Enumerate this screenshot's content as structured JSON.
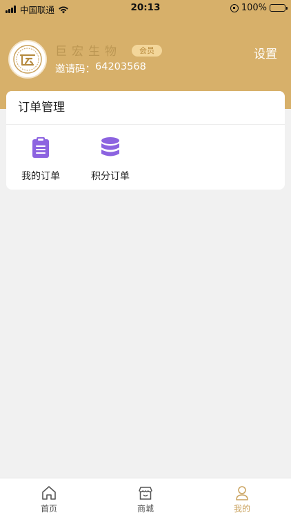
{
  "status_bar": {
    "carrier": "中国联通",
    "time": "20:13",
    "battery": "100%"
  },
  "profile": {
    "name": "巨宏生物",
    "badge": "会员",
    "invite_label": "邀请码：",
    "invite_code": "64203568",
    "settings_label": "设置"
  },
  "orders": {
    "title": "订单管理",
    "items": [
      {
        "label": "我的订单",
        "icon": "clipboard-icon"
      },
      {
        "label": "积分订单",
        "icon": "database-icon"
      }
    ]
  },
  "tabbar": {
    "items": [
      {
        "label": "首页",
        "icon": "home-icon"
      },
      {
        "label": "商城",
        "icon": "store-icon"
      },
      {
        "label": "我的",
        "icon": "user-icon",
        "active": true
      }
    ]
  },
  "colors": {
    "header_bg": "#d7b06a",
    "accent": "#c9a15c",
    "icon_purple": "#8c63e0",
    "page_bg": "#f1f1f1"
  }
}
